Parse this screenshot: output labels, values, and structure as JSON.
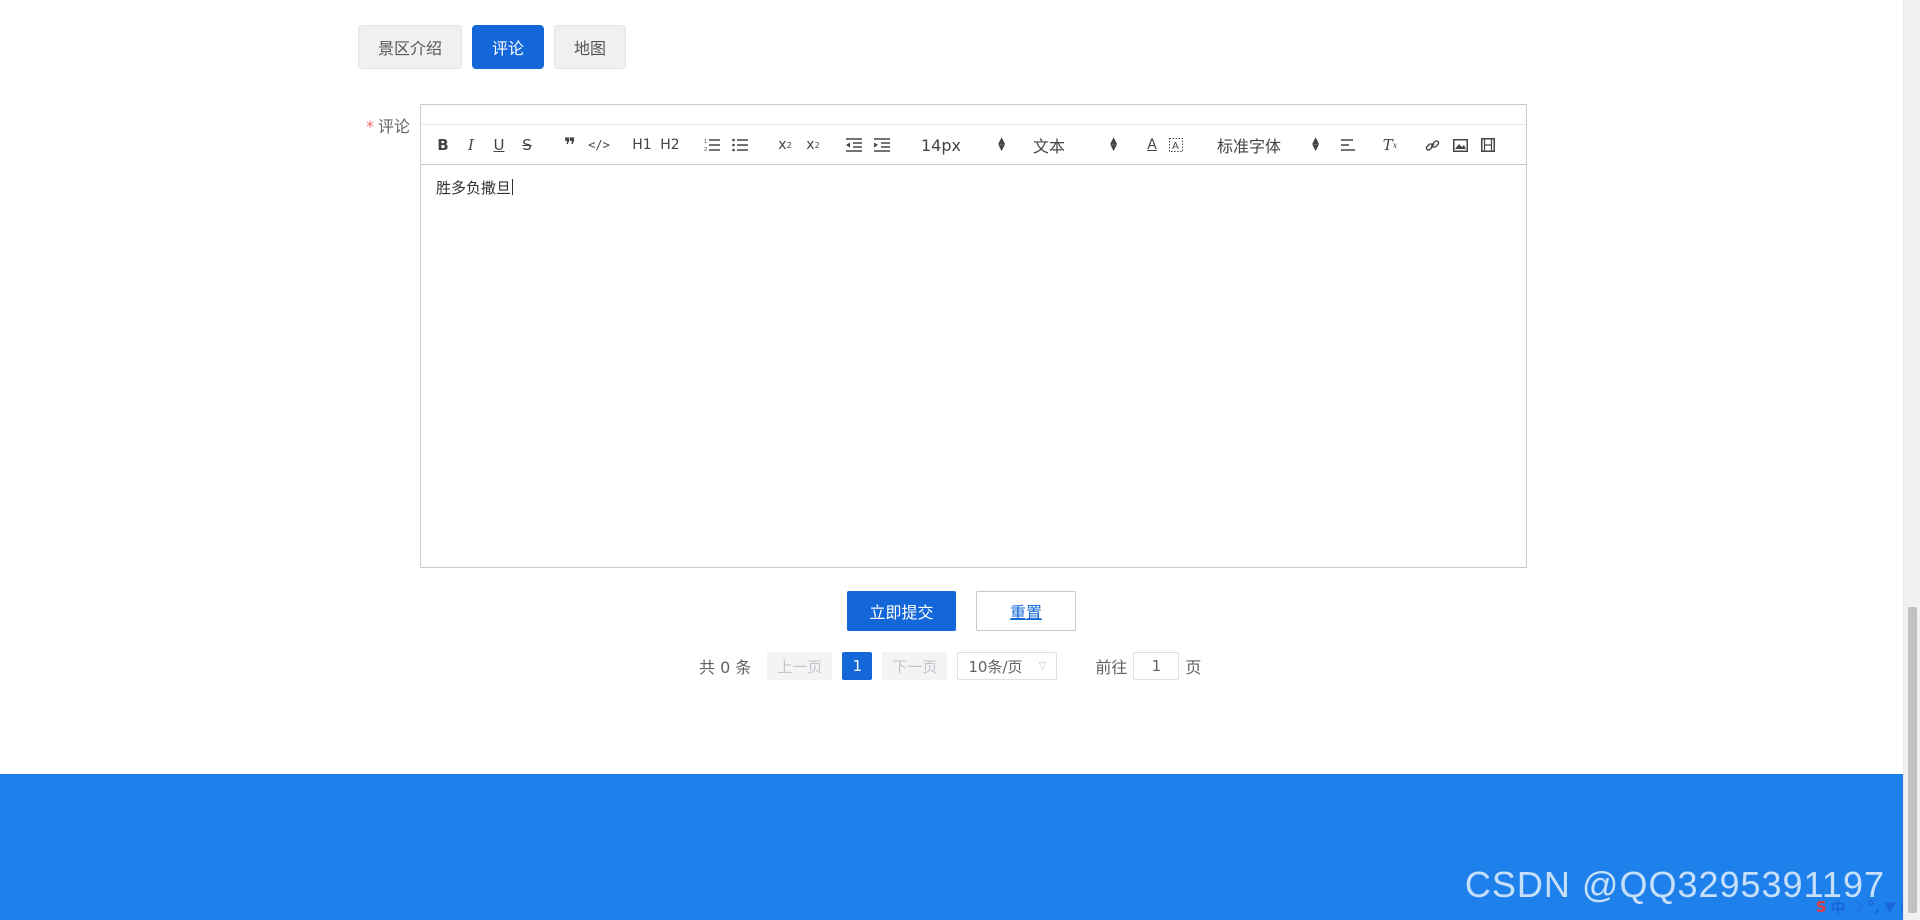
{
  "tabs": [
    {
      "label": "景区介绍",
      "active": false
    },
    {
      "label": "评论",
      "active": true
    },
    {
      "label": "地图",
      "active": false
    }
  ],
  "form": {
    "required_mark": "*",
    "label": "评论"
  },
  "editor": {
    "toolbar": {
      "size_value": "14px",
      "header_value": "文本",
      "font_value": "标准字体",
      "h1": "H1",
      "h2": "H2"
    },
    "content": "胜多负撒旦"
  },
  "buttons": {
    "submit": "立即提交",
    "reset": "重置"
  },
  "pagination": {
    "total": "共 0 条",
    "prev": "上一页",
    "current": "1",
    "next": "下一页",
    "page_size": "10条/页",
    "goto_prefix": "前往",
    "goto_value": "1",
    "goto_suffix": "页"
  },
  "watermark": "CSDN @QQ3295391197",
  "ime": {
    "s": "S",
    "lang": "中"
  },
  "colors": {
    "primary": "#1467d8",
    "footer": "#1e80ea",
    "required": "#f56c6c"
  }
}
